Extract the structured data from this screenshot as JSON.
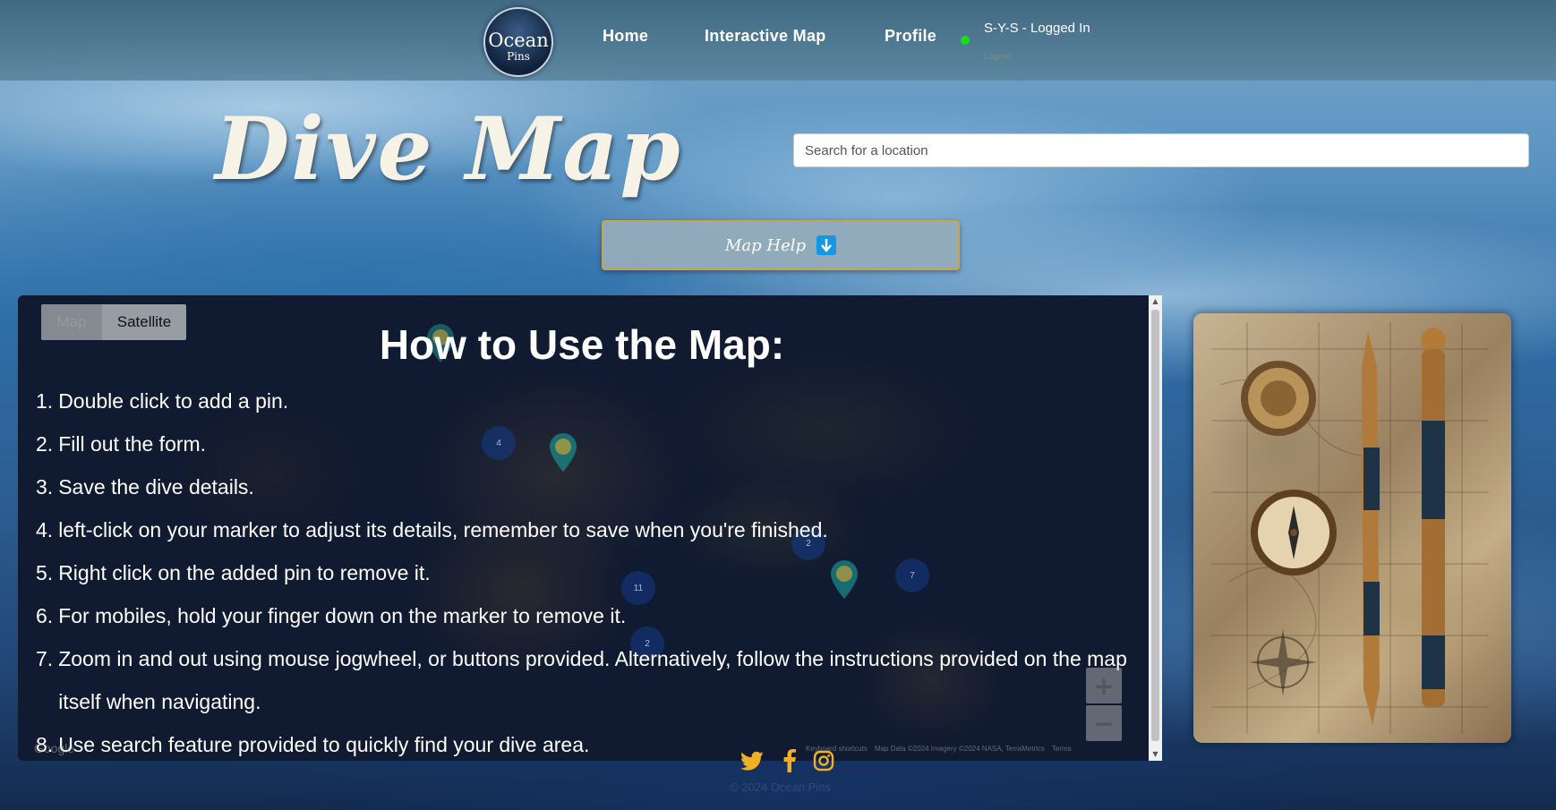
{
  "nav": {
    "logo_top": "Ocean",
    "logo_bottom": "Pins",
    "links": [
      "Home",
      "Interactive Map",
      "Profile"
    ],
    "status": "S-Y-S - Logged In",
    "logout": "Logout"
  },
  "hero": {
    "title": "Dive Map",
    "search_placeholder": "Search for a location",
    "help_button": "Map Help"
  },
  "map": {
    "type_controls": [
      "Map",
      "Satellite"
    ],
    "selected_type": "Satellite",
    "clusters": [
      "4",
      "2",
      "11",
      "7",
      "2"
    ],
    "zoom_in": "+",
    "zoom_out": "−",
    "google": "Google",
    "attribution": [
      "Keyboard shortcuts",
      "Map Data ©2024 Imagery ©2024 NASA, TerraMetrics",
      "Terms"
    ]
  },
  "help": {
    "heading": "How to Use the Map:",
    "steps": [
      "Double click to add a pin.",
      "Fill out the form.",
      "Save the dive details.",
      "left-click on your marker to adjust its details, remember to save when you're finished.",
      "Right click on the added pin to remove it.",
      "For mobiles, hold your finger down on the marker to remove it.",
      "Zoom in and out using mouse jogwheel, or buttons provided. Alternatively, follow the instructions provided on the map itself when navigating.",
      "Use search feature provided to quickly find your dive area."
    ],
    "numbers": [
      "1.",
      "2.",
      "3.",
      "4.",
      "5.",
      "6.",
      "7.",
      "8."
    ]
  },
  "footer": {
    "social": [
      "twitter-icon",
      "facebook-icon",
      "instagram-icon"
    ],
    "copyright": "© 2024 Ocean Pins"
  },
  "colors": {
    "accent_gold": "#c9a547",
    "status_green": "#16e016",
    "social_gold": "#f0b024"
  }
}
